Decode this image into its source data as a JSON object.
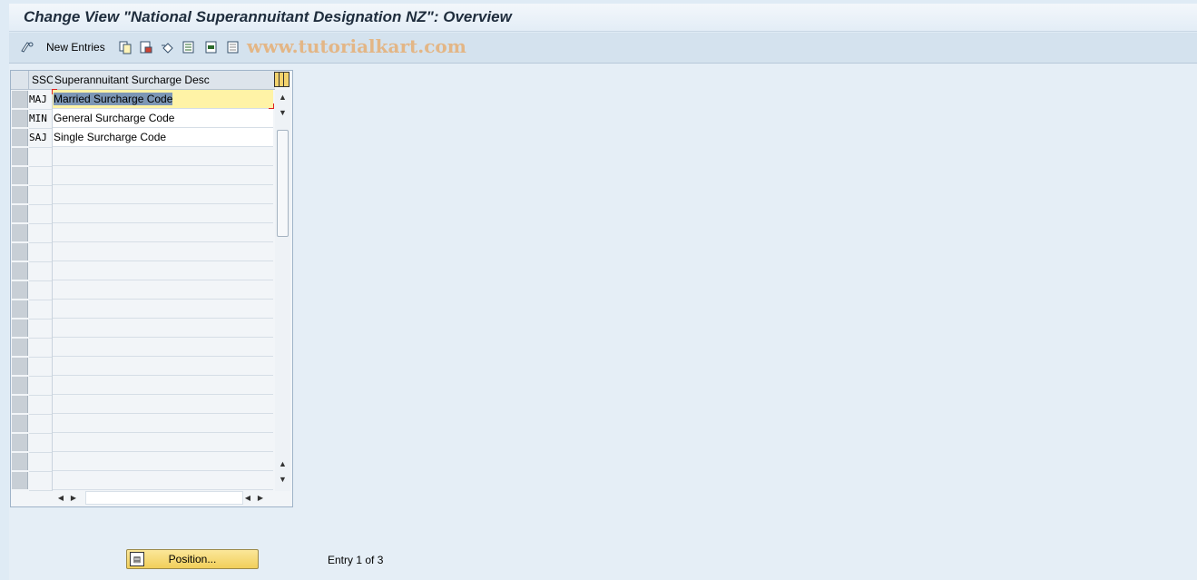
{
  "window": {
    "title": "Change View \"National Superannuitant Designation NZ\": Overview"
  },
  "toolbar": {
    "new_entries_label": "New Entries",
    "watermark": "www.tutorialkart.com",
    "icons": [
      "edit-glasses-icon",
      "copy-icon",
      "save-variant-icon",
      "undo-change-icon",
      "select-all-icon",
      "select-block-icon",
      "deselect-icon"
    ]
  },
  "table": {
    "columns": {
      "ssc": "SSC",
      "desc": "Superannuitant Surcharge Desc"
    },
    "rows": [
      {
        "ssc": "MAJ",
        "desc": "Married Surcharge Code"
      },
      {
        "ssc": "MIN",
        "desc": "General Surcharge Code"
      },
      {
        "ssc": "SAJ",
        "desc": "Single Surcharge Code"
      }
    ]
  },
  "footer": {
    "position_label": "Position...",
    "entry_info": "Entry 1 of 3"
  }
}
